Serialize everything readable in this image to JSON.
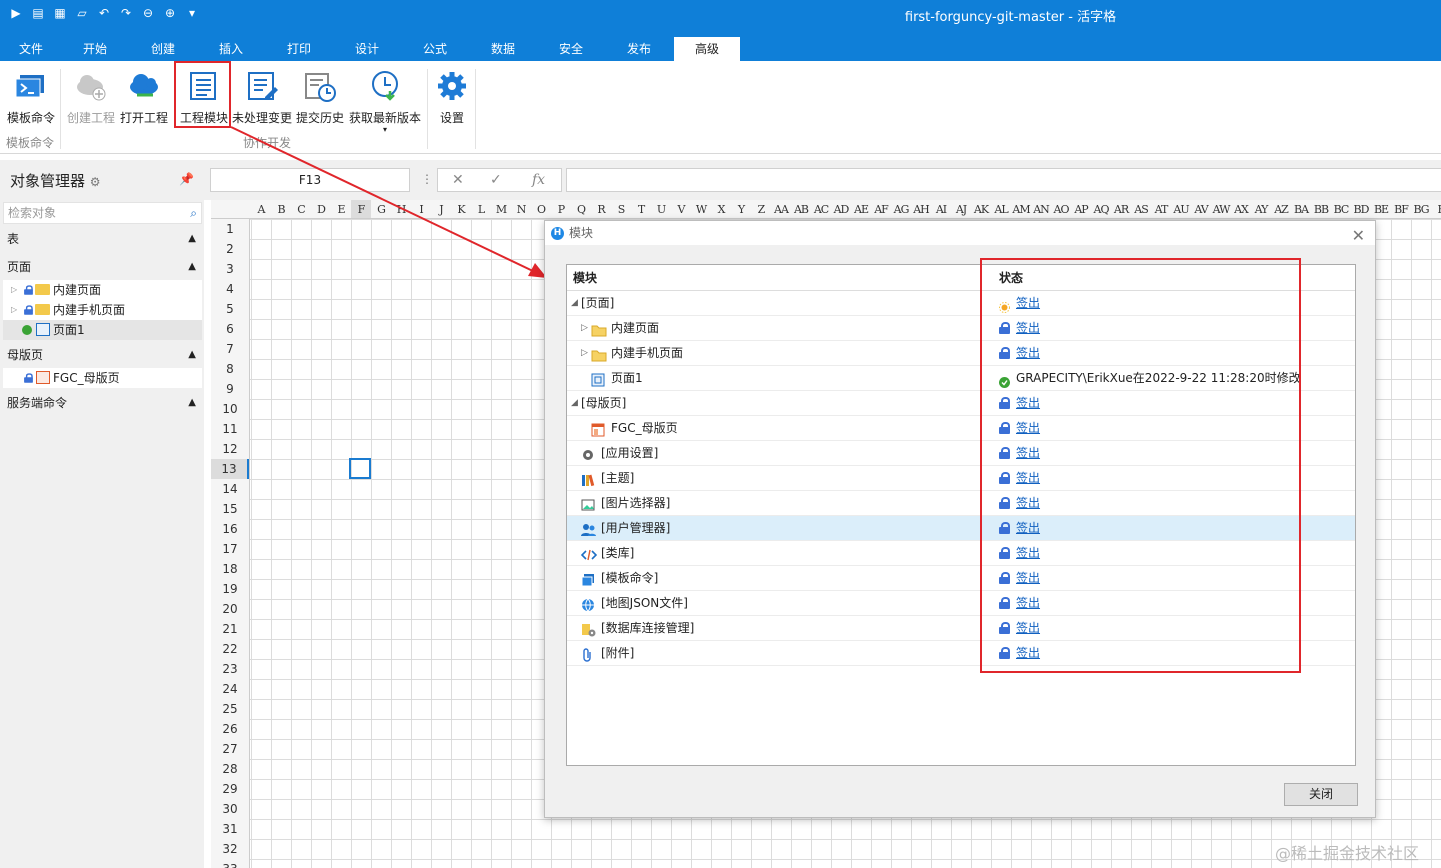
{
  "window": {
    "title": "first-forguncy-git-master - 活字格"
  },
  "quick_access": [
    "run-icon",
    "save-icon",
    "save-all-icon",
    "open-icon",
    "undo-icon",
    "redo-icon",
    "back-icon",
    "forward-icon",
    "customize-icon"
  ],
  "menu": {
    "tabs": [
      "文件",
      "开始",
      "创建",
      "插入",
      "打印",
      "设计",
      "公式",
      "数据",
      "安全",
      "发布",
      "高级"
    ],
    "active": "高级"
  },
  "ribbon": {
    "template_cmd": "模板命令",
    "create_project": "创建工程",
    "open_project": "打开工程",
    "project_modules": "工程模块",
    "pending_changes": "未处理变更",
    "commit_history": "提交历史",
    "get_latest": "获取最新版本",
    "settings": "设置",
    "group_template": "模板命令",
    "group_collab": "协作开发"
  },
  "object_manager": {
    "title": "对象管理器",
    "search_placeholder": "检索对象",
    "sections": {
      "tables": "表",
      "pages": "页面",
      "master": "母版页",
      "server": "服务端命令"
    },
    "pages": [
      "内建页面",
      "内建手机页面",
      "页面1"
    ],
    "master_pages": [
      "FGC_母版页"
    ]
  },
  "formula_bar": {
    "cell_ref": "F13",
    "fx": "fx"
  },
  "sheet": {
    "columns": [
      "A",
      "B",
      "C",
      "D",
      "E",
      "F",
      "G",
      "H",
      "I",
      "J",
      "K",
      "L",
      "M",
      "N",
      "O",
      "P",
      "Q",
      "R",
      "S",
      "T",
      "U",
      "V",
      "W",
      "X",
      "Y",
      "Z",
      "AA",
      "AB",
      "AC",
      "AD",
      "AE",
      "AF",
      "AG",
      "AH",
      "AI",
      "AJ",
      "AK",
      "AL",
      "AM",
      "AN",
      "AO",
      "AP",
      "AQ",
      "AR",
      "AS",
      "AT",
      "AU",
      "AV",
      "AW",
      "AX",
      "AY",
      "AZ",
      "BA",
      "BB",
      "BC",
      "BD",
      "BE",
      "BF",
      "BG",
      "B"
    ],
    "rows": [
      "1",
      "2",
      "3",
      "4",
      "5",
      "6",
      "7",
      "8",
      "9",
      "10",
      "11",
      "12",
      "13",
      "14",
      "15",
      "16",
      "17",
      "18",
      "19",
      "20",
      "21",
      "22",
      "23",
      "24",
      "25",
      "26",
      "27",
      "28",
      "29",
      "30",
      "31",
      "32",
      "33"
    ],
    "current_row": "13"
  },
  "dialog": {
    "title": "模块",
    "col_module": "模块",
    "col_status": "状态",
    "close_label": "关闭",
    "rows": [
      {
        "label": "[页面]",
        "status": "签出"
      },
      {
        "label": "内建页面",
        "status": "签出"
      },
      {
        "label": "内建手机页面",
        "status": "签出"
      },
      {
        "label": "页面1",
        "status": "GRAPECITY\\ErikXue在2022-9-22 11:28:20时修改"
      },
      {
        "label": "[母版页]",
        "status": "签出"
      },
      {
        "label": "FGC_母版页",
        "status": "签出"
      },
      {
        "label": "[应用设置]",
        "status": "签出"
      },
      {
        "label": "[主题]",
        "status": "签出"
      },
      {
        "label": "[图片选择器]",
        "status": "签出"
      },
      {
        "label": "[用户管理器]",
        "status": "签出"
      },
      {
        "label": "[类库]",
        "status": "签出"
      },
      {
        "label": "[模板命令]",
        "status": "签出"
      },
      {
        "label": "[地图JSON文件]",
        "status": "签出"
      },
      {
        "label": "[数据库连接管理]",
        "status": "签出"
      },
      {
        "label": "[附件]",
        "status": "签出"
      }
    ]
  },
  "watermark": "@稀土掘金技术社区",
  "colors": {
    "accent": "#0f7fd8",
    "highlight": "#e0262b",
    "link": "#1060c0"
  }
}
